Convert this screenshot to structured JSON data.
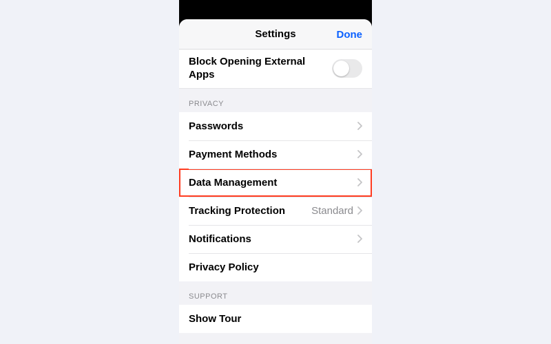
{
  "nav": {
    "title": "Settings",
    "done": "Done"
  },
  "block_opening": {
    "label": "Block Opening External Apps",
    "on": false
  },
  "sections": {
    "privacy": {
      "header": "PRIVACY",
      "items": [
        {
          "label": "Passwords",
          "disclosure": true
        },
        {
          "label": "Payment Methods",
          "disclosure": true
        },
        {
          "label": "Data Management",
          "disclosure": true,
          "highlighted": true
        },
        {
          "label": "Tracking Protection",
          "value": "Standard",
          "disclosure": true
        },
        {
          "label": "Notifications",
          "disclosure": true
        },
        {
          "label": "Privacy Policy",
          "disclosure": false
        }
      ]
    },
    "support": {
      "header": "SUPPORT",
      "items": [
        {
          "label": "Show Tour",
          "disclosure": false
        }
      ]
    }
  }
}
